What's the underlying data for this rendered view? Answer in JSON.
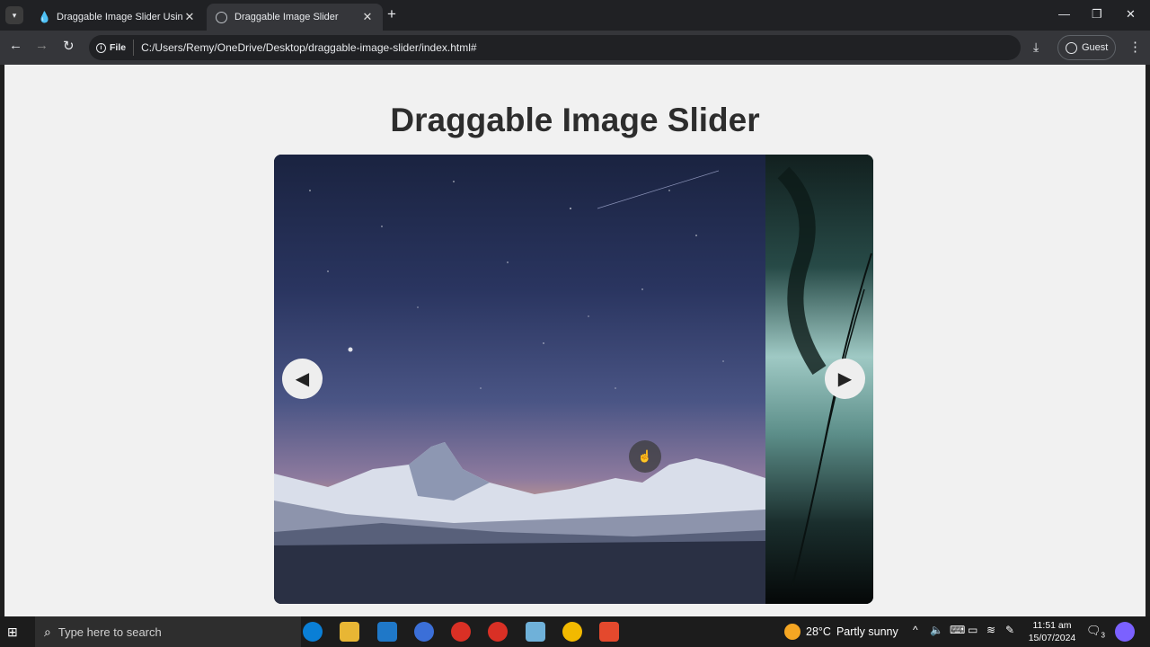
{
  "browser": {
    "tabs": [
      {
        "title": "Draggable Image Slider Using I",
        "active": false
      },
      {
        "title": "Draggable Image Slider",
        "active": true
      }
    ],
    "new_tab_symbol": "+",
    "address": {
      "scheme_chip": "File",
      "url": "C:/Users/Remy/OneDrive/Desktop/draggable-image-slider/index.html#"
    },
    "profile_label": "Guest"
  },
  "page": {
    "heading": "Draggable Image Slider",
    "slider": {
      "slides": [
        "starry-sky-over-snowy-mountains",
        "misty-jungle-vines"
      ],
      "prev_icon": "chevron-left-icon",
      "next_icon": "chevron-right-icon"
    }
  },
  "taskbar": {
    "search_placeholder": "Type here to search",
    "weather_temp": "28°C",
    "weather_text": "Partly sunny",
    "time": "11:51 am",
    "date": "15/07/2024",
    "notification_count": "3",
    "apps": [
      "edge-icon",
      "file-explorer-icon",
      "vscode-icon",
      "app-icon",
      "chrome-icon",
      "chrome-icon",
      "app-icon",
      "chrome-icon",
      "app-icon"
    ]
  },
  "colors": {
    "page_bg": "#f1f1f1",
    "heading": "#2d2d2d",
    "browser_chrome": "#202124"
  }
}
